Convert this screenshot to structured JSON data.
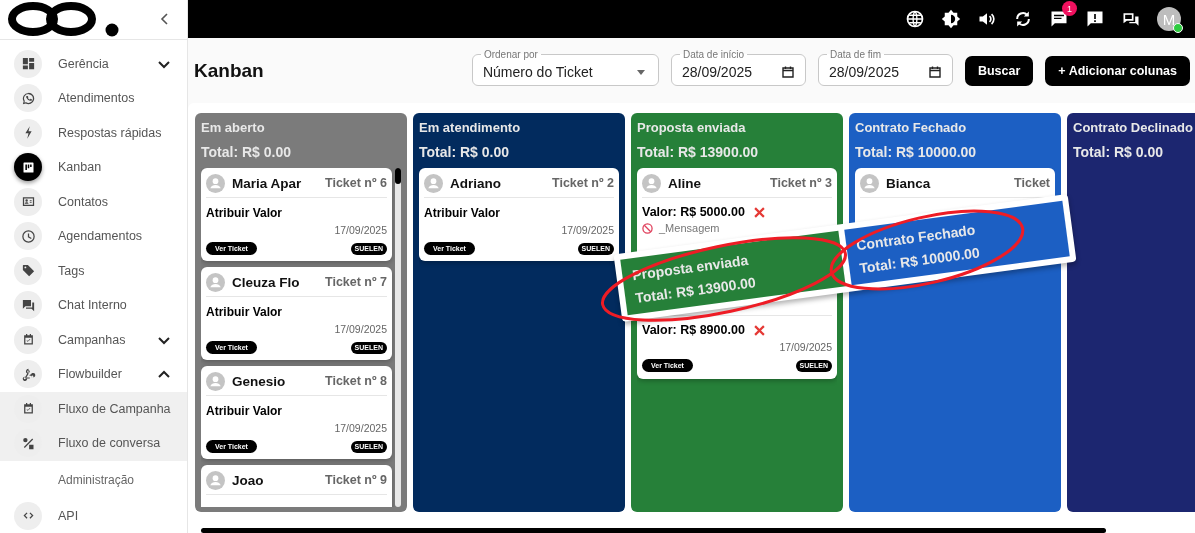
{
  "sidebar": {
    "items": [
      {
        "label": "Gerência",
        "kind": "item",
        "expandable": true,
        "expanded": false,
        "selected": false
      },
      {
        "label": "Atendimentos",
        "kind": "item",
        "selected": false
      },
      {
        "label": "Respostas rápidas",
        "kind": "item",
        "selected": false
      },
      {
        "label": "Kanban",
        "kind": "item",
        "selected": true
      },
      {
        "label": "Contatos",
        "kind": "item",
        "selected": false
      },
      {
        "label": "Agendamentos",
        "kind": "item",
        "selected": false
      },
      {
        "label": "Tags",
        "kind": "item",
        "selected": false
      },
      {
        "label": "Chat Interno",
        "kind": "item",
        "selected": false
      },
      {
        "label": "Campanhas",
        "kind": "item",
        "expandable": true,
        "expanded": false,
        "selected": false
      },
      {
        "label": "Flowbuilder",
        "kind": "item",
        "expandable": true,
        "expanded": true,
        "selected": false,
        "children": [
          {
            "label": "Fluxo de Campanha",
            "kind": "item",
            "selected": false
          },
          {
            "label": "Fluxo de conversa",
            "kind": "item",
            "selected": false
          }
        ]
      },
      {
        "label": "Administração",
        "kind": "header"
      },
      {
        "label": "API",
        "kind": "item",
        "selected": false
      }
    ]
  },
  "top_bar": {
    "chat_badge": "1",
    "avatar_initial": "M",
    "online": true
  },
  "page": {
    "title": "Kanban"
  },
  "filters": [
    {
      "kind": "select",
      "label": "Ordenar por",
      "value": "Número do Ticket"
    },
    {
      "kind": "date",
      "label": "Data de início",
      "value": "28/09/2025"
    },
    {
      "kind": "date",
      "label": "Data de fim",
      "value": "28/09/2025"
    }
  ],
  "buttons": [
    "Buscar",
    "+ Adicionar colunas"
  ],
  "columns": [
    {
      "title": "Em aberto",
      "total": "Total: R$ 0.00",
      "color": "#7b7b7b",
      "cards": [
        {
          "kind": "assign",
          "name": "Maria Apar",
          "ticket": "Ticket nº 6",
          "action": "Atribuir Valor",
          "date": "17/09/2025",
          "button": "Ver Ticket",
          "user": "SUELEN"
        },
        {
          "kind": "assign",
          "name": "Cleuza Flo",
          "ticket": "Ticket nº 7",
          "action": "Atribuir Valor",
          "date": "17/09/2025",
          "button": "Ver Ticket",
          "user": "SUELEN"
        },
        {
          "kind": "assign",
          "name": "Genesio",
          "ticket": "Ticket nº 8",
          "action": "Atribuir Valor",
          "date": "17/09/2025",
          "button": "Ver Ticket",
          "user": "SUELEN"
        },
        {
          "kind": "assign",
          "name": "Joao",
          "ticket": "Ticket nº 9"
        }
      ]
    },
    {
      "title": "Em atendimento",
      "total": "Total: R$ 0.00",
      "color": "#022b5e",
      "cards": [
        {
          "kind": "assign",
          "name": "Adriano",
          "ticket": "Ticket nº 2",
          "action": "Atribuir Valor",
          "date": "17/09/2025",
          "button": "Ver Ticket",
          "user": "SUELEN"
        }
      ]
    },
    {
      "title": "Proposta enviada",
      "total": "Total: R$ 13900.00",
      "color": "#268039",
      "cards": [
        {
          "kind": "value",
          "name": "Aline",
          "ticket": "Ticket nº 3",
          "value": "Valor: R$ 5000.00",
          "message": "_Mensagem"
        },
        {
          "kind": "value",
          "value": "Valor: R$ 8900.00",
          "date": "17/09/2025",
          "button": "Ver Ticket",
          "user": "SUELEN"
        }
      ]
    },
    {
      "title": "Contrato Fechado",
      "total": "Total: R$ 10000.00",
      "color": "#1c5fc3",
      "cards": [
        {
          "kind": "hidden",
          "name": "Bianca",
          "ticket": "Ticket"
        }
      ]
    },
    {
      "title": "Contrato Declinado",
      "total": "Total: R$ 0.00",
      "color": "#1c2670"
    }
  ],
  "callout": {
    "sections": [
      {
        "title": "Proposta enviada",
        "total": "Total: R$ 13900.00",
        "color": "#268039"
      },
      {
        "title": "Contrato Fechado",
        "total": "Total: R$ 10000.00",
        "color": "#1c5fc3"
      }
    ]
  }
}
